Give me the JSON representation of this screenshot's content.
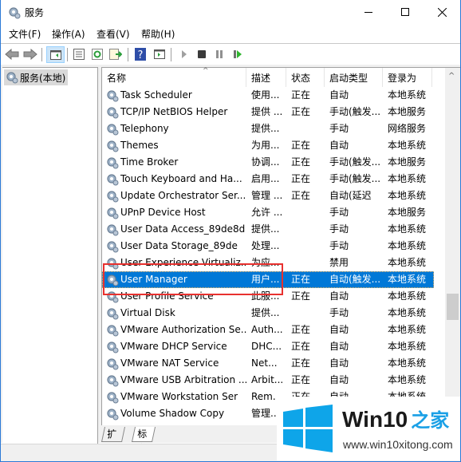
{
  "window": {
    "title": "服务",
    "controls": {
      "minimize": "minimize",
      "maximize": "maximize",
      "close": "close"
    }
  },
  "menu": [
    "文件(F)",
    "操作(A)",
    "查看(V)",
    "帮助(H)"
  ],
  "toolbar": {
    "buttons": [
      {
        "icon": "back-arrow-icon"
      },
      {
        "icon": "forward-arrow-icon"
      },
      {
        "icon": "show-hide-console-tree-icon",
        "active": true
      },
      {
        "icon": "properties-icon"
      },
      {
        "icon": "refresh-icon"
      },
      {
        "icon": "export-list-icon"
      },
      {
        "icon": "help-icon"
      },
      {
        "icon": "show-hide-action-pane-icon"
      },
      {
        "icon": "start-service-icon"
      },
      {
        "icon": "stop-service-icon"
      },
      {
        "icon": "pause-service-icon"
      },
      {
        "icon": "restart-service-icon"
      }
    ]
  },
  "tree": {
    "root_label": "服务(本地)"
  },
  "table": {
    "columns": [
      "名称",
      "描述",
      "状态",
      "启动类型",
      "登录为"
    ],
    "rows": [
      {
        "name": "Task Scheduler",
        "desc": "使用...",
        "status": "正在",
        "startup": "自动",
        "logon": "本地系统"
      },
      {
        "name": "TCP/IP NetBIOS Helper",
        "desc": "提供 ...",
        "status": "正在",
        "startup": "手动(触发...",
        "logon": "本地服务"
      },
      {
        "name": "Telephony",
        "desc": "提供...",
        "status": "",
        "startup": "手动",
        "logon": "网络服务"
      },
      {
        "name": "Themes",
        "desc": "为用...",
        "status": "正在",
        "startup": "自动",
        "logon": "本地系统"
      },
      {
        "name": "Time Broker",
        "desc": "协调...",
        "status": "正在",
        "startup": "手动(触发...",
        "logon": "本地服务"
      },
      {
        "name": "Touch Keyboard and Ha...",
        "desc": "启用...",
        "status": "正在",
        "startup": "手动(触发...",
        "logon": "本地系统"
      },
      {
        "name": "Update Orchestrator Ser...",
        "desc": "管理 ...",
        "status": "正在",
        "startup": "自动(延迟",
        "logon": "本地系统"
      },
      {
        "name": "UPnP Device Host",
        "desc": "允许 ...",
        "status": "",
        "startup": "手动",
        "logon": "本地服务"
      },
      {
        "name": "User Data Access_89de8d",
        "desc": "提供...",
        "status": "",
        "startup": "手动",
        "logon": "本地系统"
      },
      {
        "name": "User Data Storage_89de",
        "desc": "处理...",
        "status": "",
        "startup": "手动",
        "logon": "本地系统"
      },
      {
        "name": "User Experience Virtualiz...",
        "desc": "为应...",
        "status": "",
        "startup": "禁用",
        "logon": "本地系统"
      },
      {
        "name": "User Manager",
        "desc": "用户...",
        "status": "正在",
        "startup": "自动(触发...",
        "logon": "本地系统",
        "selected": true
      },
      {
        "name": "User Profile Service",
        "desc": "此服...",
        "status": "正在",
        "startup": "自动",
        "logon": "本地系统"
      },
      {
        "name": "Virtual Disk",
        "desc": "提供...",
        "status": "",
        "startup": "手动",
        "logon": "本地系统"
      },
      {
        "name": "VMware Authorization Se...",
        "desc": "Auth...",
        "status": "正在",
        "startup": "自动",
        "logon": "本地系统"
      },
      {
        "name": "VMware DHCP Service",
        "desc": "DHC...",
        "status": "正在",
        "startup": "自动",
        "logon": "本地系统"
      },
      {
        "name": "VMware NAT Service",
        "desc": "Net...",
        "status": "正在",
        "startup": "自动",
        "logon": "本地系统"
      },
      {
        "name": "VMware USB Arbitration ...",
        "desc": "Arbit...",
        "status": "正在",
        "startup": "自动",
        "logon": "本地系统"
      },
      {
        "name": "VMware Workstation Ser",
        "desc": "Rem.",
        "status": "正在",
        "startup": "自动",
        "logon": "本地系统"
      },
      {
        "name": "Volume Shadow Copy",
        "desc": "管理..",
        "status": "",
        "startup": "",
        "logon": ""
      }
    ]
  },
  "tabs": [
    "扩展",
    "标准"
  ],
  "active_tab": "标准",
  "watermark": {
    "title": "Win10",
    "title_cn": "之家",
    "url": "www.win10xitong.com"
  },
  "colors": {
    "selection": "#0078d7",
    "highlight_border": "#e8312f",
    "window_border": "#2b79d6",
    "watermark_blue": "#1aa0e6"
  }
}
